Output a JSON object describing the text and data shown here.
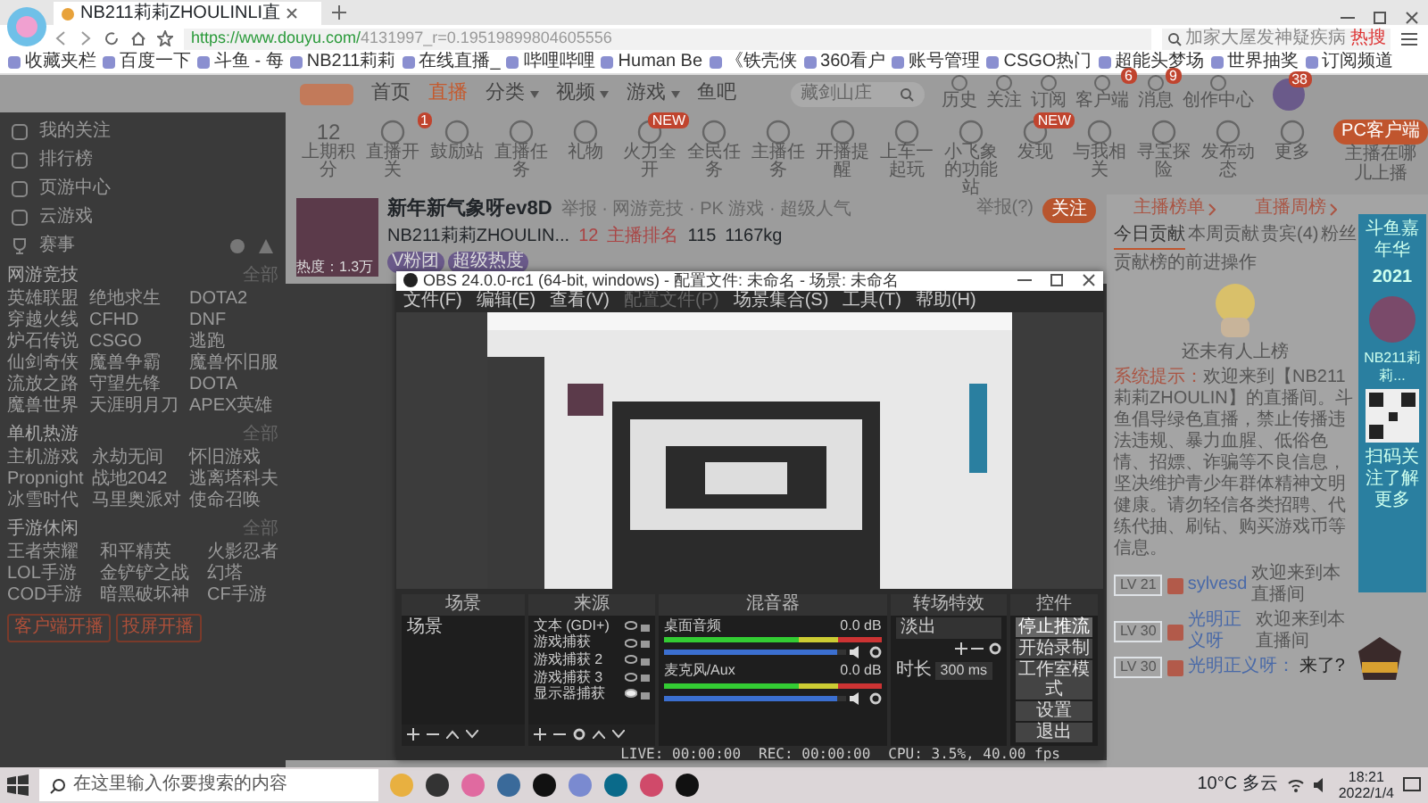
{
  "browser": {
    "tab_title": "NB211莉莉ZHOULINLI直",
    "url_host": "https://www.douyu.com/",
    "url_path": "4131997_r=0.19519899804605556",
    "search_placeholder": "加家大屋发神疑疾病",
    "search_badge": "热搜",
    "bookmarks": [
      "收藏夹栏",
      "百度一下",
      "斗鱼 - 每",
      "NB211莉莉",
      "在线直播_",
      "哔哩哔哩",
      "Human Be",
      "《铁壳侠",
      "360看户",
      "账号管理",
      "CSGO热门",
      "超能头梦场",
      "世界抽奖",
      "订阅频道"
    ]
  },
  "site": {
    "nav": [
      {
        "label": "首页",
        "selected": false,
        "caret": false
      },
      {
        "label": "直播",
        "selected": true,
        "caret": false
      },
      {
        "label": "分类",
        "selected": false,
        "caret": true
      },
      {
        "label": "视频",
        "selected": false,
        "caret": true
      },
      {
        "label": "游戏",
        "selected": false,
        "caret": true
      },
      {
        "label": "鱼吧",
        "selected": false,
        "caret": false
      }
    ],
    "search_placeholder": "藏剑山庄",
    "header_links": [
      {
        "label": "历史"
      },
      {
        "label": "关注"
      },
      {
        "label": "订阅"
      },
      {
        "label": "客户端",
        "badge": "6"
      },
      {
        "label": "消息",
        "badge": "9"
      },
      {
        "label": "创作中心"
      }
    ],
    "avatar_badge": "38",
    "sidebar_links": [
      "我的关注",
      "排行榜",
      "页游中心",
      "云游戏"
    ],
    "sidebar_row_label": "赛事",
    "sections": [
      {
        "title": "网游竞技",
        "more": "全部",
        "items": [
          "英雄联盟",
          "绝地求生",
          "DOTA2",
          "穿越火线",
          "CFHD",
          "DNF",
          "炉石传说",
          "CSGO",
          "逃跑",
          "仙剑奇侠",
          "魔兽争霸",
          "魔兽怀旧服",
          "流放之路",
          "守望先锋",
          "DOTA",
          "魔兽世界",
          "天涯明月刀",
          "APEX英雄"
        ]
      },
      {
        "title": "单机热游",
        "more": "全部",
        "items": [
          "主机游戏",
          "永劫无间",
          "怀旧游戏",
          "Propnight",
          "战地2042",
          "逃离塔科夫",
          "冰雪时代",
          "马里奥派对",
          "使命召唤"
        ]
      },
      {
        "title": "手游休闲",
        "more": "全部",
        "items": [
          "王者荣耀",
          "和平精英",
          "火影忍者",
          "LOL手游",
          "金铲铲之战",
          "幻塔",
          "COD手游",
          "暗黑破坏神",
          "CF手游"
        ]
      }
    ],
    "sidebar_buttons": [
      "客户端开播",
      "投屏开播"
    ],
    "toolbar": [
      {
        "label": "上期积分",
        "value": "12"
      },
      {
        "label": "直播开关",
        "badge": "1"
      },
      {
        "label": "鼓励站"
      },
      {
        "label": "直播任务"
      },
      {
        "label": "礼物"
      },
      {
        "label": "火力全开",
        "badge": "NEW"
      },
      {
        "label": "全民任务"
      },
      {
        "label": "主播任务"
      },
      {
        "label": "开播提醒"
      },
      {
        "label": "上车一起玩"
      },
      {
        "label": "小飞象的功能站"
      },
      {
        "label": "发现",
        "badge": "NEW"
      },
      {
        "label": "与我相关"
      },
      {
        "label": "寻宝探险"
      },
      {
        "label": "发布动态"
      },
      {
        "label": "更多"
      }
    ],
    "pc_button": "PC客户端",
    "pc_hint": "主播在哪儿上播",
    "room": {
      "title": "新年新气象呀ev8D",
      "tag_line": "举报 · 网游竞技 · PK 游戏 · 超级人气",
      "streamer": "NB211莉莉ZHOULIN...",
      "hot": "12",
      "rank": "主播排名",
      "fans": "115",
      "weight": "1167kg",
      "thumb_caption": "热度：1.3万",
      "chips": [
        "V粉团",
        "超级热度"
      ],
      "report": "举报(?)",
      "follow": "关注"
    },
    "rank_links": [
      "主播榜单",
      "直播周榜"
    ],
    "rank_tabs": [
      {
        "label": "今日贡献",
        "selected": true
      },
      {
        "label": "本周贡献",
        "selected": false
      },
      {
        "label": "贵宾(4)",
        "selected": false
      },
      {
        "label": "粉丝",
        "selected": false
      }
    ],
    "rank_hint": "贡献榜的前进操作",
    "empty_text": "还未有人上榜",
    "system_label": "系统提示：",
    "system_text": "欢迎来到【NB211莉莉ZHOULIN】的直播间。斗鱼倡导绿色直播，禁止传播违法违规、暴力血腥、低俗色情、招嫖、诈骗等不良信息，坚决维护青少年群体精神文明健康。请勿轻信各类招聘、代练代抽、刷钻、购买游戏币等信息。",
    "chat": [
      {
        "level": "LV 21",
        "name": "sylvesd",
        "text": "欢迎来到本直播间",
        "kind": "enter"
      },
      {
        "level": "LV 30",
        "name": "光明正义呀",
        "text": "欢迎来到本直播间",
        "kind": "enter"
      },
      {
        "level": "LV 30",
        "name": "光明正义呀：",
        "text": "来了?",
        "kind": "message"
      }
    ],
    "promo": {
      "title": "斗鱼嘉年华",
      "year": "2021",
      "name": "NB211莉莉...",
      "hint": "扫码关注了解更多"
    }
  },
  "obs": {
    "title": "OBS 24.0.0-rc1 (64-bit, windows) - 配置文件: 未命名 - 场景: 未命名",
    "menu": [
      {
        "label": "文件(F)",
        "disabled": false
      },
      {
        "label": "编辑(E)",
        "disabled": false
      },
      {
        "label": "查看(V)",
        "disabled": false
      },
      {
        "label": "配置文件(P)",
        "disabled": true
      },
      {
        "label": "场景集合(S)",
        "disabled": false
      },
      {
        "label": "工具(T)",
        "disabled": false
      },
      {
        "label": "帮助(H)",
        "disabled": false
      }
    ],
    "docks": {
      "scenes": "场景",
      "sources": "来源",
      "mixer": "混音器",
      "transitions": "转场特效",
      "controls": "控件"
    },
    "scenes": [
      {
        "label": "场景",
        "selected": false
      }
    ],
    "sources": [
      {
        "label": "文本 (GDI+)",
        "visible": false
      },
      {
        "label": "游戏捕获",
        "visible": false
      },
      {
        "label": "游戏捕获 2",
        "visible": false
      },
      {
        "label": "游戏捕获 3",
        "visible": false
      },
      {
        "label": "显示器捕获",
        "visible": true
      }
    ],
    "channels": [
      {
        "name": "桌面音频",
        "reading": "0.0 dB",
        "level": 0.95
      },
      {
        "name": "麦克风/Aux",
        "reading": "0.0 dB",
        "level": 0.95
      }
    ],
    "transition": "淡出",
    "duration_label": "时长",
    "duration": "300 ms",
    "controls": [
      {
        "label": "停止推流",
        "selected": true
      },
      {
        "label": "开始录制",
        "selected": false
      },
      {
        "label": "工作室模式",
        "selected": false
      },
      {
        "label": "设置",
        "selected": false
      },
      {
        "label": "退出",
        "selected": false
      }
    ],
    "status": [
      "LIVE: 00:00:00",
      "REC: 00:00:00",
      "CPU: 3.5%, 40.00 fps"
    ]
  },
  "taskbar": {
    "search_placeholder": "在这里输入你要搜索的内容",
    "weather": "10°C 多云",
    "time": "18:21",
    "date": "2022/1/4"
  }
}
